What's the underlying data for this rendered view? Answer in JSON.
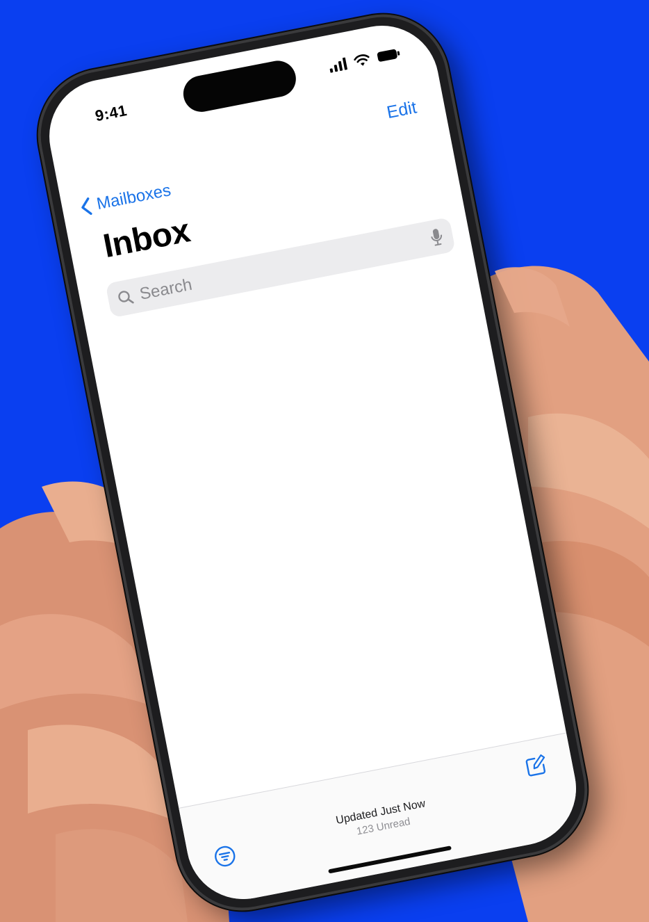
{
  "status_bar": {
    "time": "9:41"
  },
  "nav": {
    "back_label": "Mailboxes",
    "edit_label": "Edit",
    "title": "Inbox"
  },
  "search": {
    "placeholder": "Search"
  },
  "toolbar": {
    "updated_text": "Updated Just Now",
    "unread_text": "123 Unread"
  },
  "icons": {
    "signal": "cellular-signal-icon",
    "wifi": "wifi-icon",
    "battery": "battery-icon",
    "back": "chevron-left-icon",
    "search": "magnifying-glass-icon",
    "dictation": "microphone-icon",
    "filter": "filter-icon",
    "compose": "compose-icon"
  },
  "colors": {
    "background": "#0a3ff0",
    "accent": "#1a73e8",
    "skin": "#e9ae8f"
  }
}
